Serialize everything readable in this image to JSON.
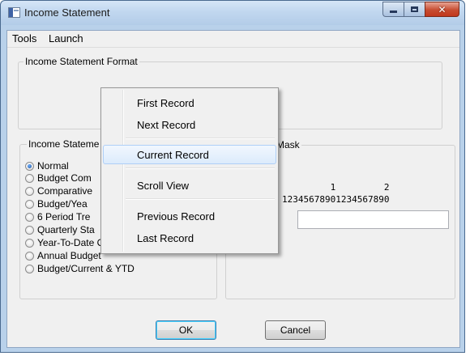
{
  "window": {
    "title": "Income Statement"
  },
  "menubar": {
    "items": [
      "Tools",
      "Launch"
    ]
  },
  "format_group": {
    "title": "Income Statement Format"
  },
  "type_group": {
    "title": "Income Stateme",
    "options": [
      {
        "label": "Normal",
        "checked": true
      },
      {
        "label": "Budget Com",
        "checked": false
      },
      {
        "label": "Comparative",
        "checked": false
      },
      {
        "label": "Budget/Yea",
        "checked": false
      },
      {
        "label": "6 Period Tre",
        "checked": false
      },
      {
        "label": "Quarterly Sta",
        "checked": false
      },
      {
        "label": "Year-To-Date Only",
        "checked": false
      },
      {
        "label": "Annual Budget",
        "checked": false
      },
      {
        "label": "Budget/Current & YTD",
        "checked": false
      }
    ]
  },
  "mask_group": {
    "title": "Mask",
    "ruler_tens": "         1         2",
    "ruler_units": "12345678901234567890",
    "value": ""
  },
  "buttons": {
    "ok": "OK",
    "cancel": "Cancel"
  },
  "context_menu": {
    "items": [
      "First Record",
      "Next Record",
      "Current Record",
      "Scroll View",
      "Previous Record",
      "Last Record"
    ],
    "highlighted": "Current Record"
  }
}
